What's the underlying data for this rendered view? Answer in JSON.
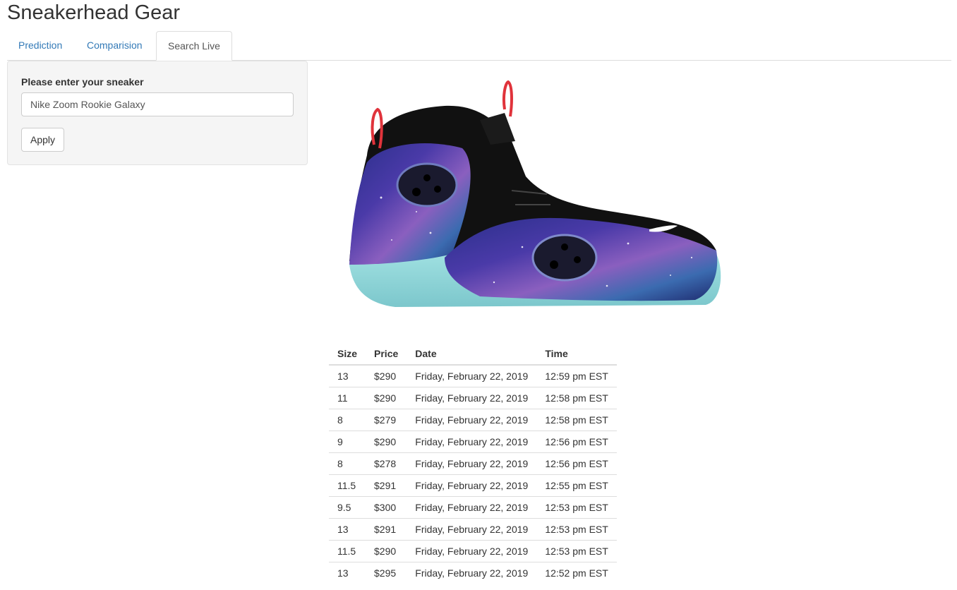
{
  "app": {
    "title": "Sneakerhead Gear"
  },
  "tabs": [
    {
      "label": "Prediction"
    },
    {
      "label": "Comparision"
    },
    {
      "label": "Search Live"
    }
  ],
  "sidebar": {
    "input_label": "Please enter your sneaker",
    "input_value": "Nike Zoom Rookie Galaxy",
    "apply_label": "Apply"
  },
  "table": {
    "headers": [
      "Size",
      "Price",
      "Date",
      "Time"
    ],
    "rows": [
      [
        "13",
        "$290",
        "Friday, February 22, 2019",
        "12:59 pm EST"
      ],
      [
        "11",
        "$290",
        "Friday, February 22, 2019",
        "12:58 pm EST"
      ],
      [
        "8",
        "$279",
        "Friday, February 22, 2019",
        "12:58 pm EST"
      ],
      [
        "9",
        "$290",
        "Friday, February 22, 2019",
        "12:56 pm EST"
      ],
      [
        "8",
        "$278",
        "Friday, February 22, 2019",
        "12:56 pm EST"
      ],
      [
        "11.5",
        "$291",
        "Friday, February 22, 2019",
        "12:55 pm EST"
      ],
      [
        "9.5",
        "$300",
        "Friday, February 22, 2019",
        "12:53 pm EST"
      ],
      [
        "13",
        "$291",
        "Friday, February 22, 2019",
        "12:53 pm EST"
      ],
      [
        "11.5",
        "$290",
        "Friday, February 22, 2019",
        "12:53 pm EST"
      ],
      [
        "13",
        "$295",
        "Friday, February 22, 2019",
        "12:52 pm EST"
      ]
    ]
  },
  "colors": {
    "link": "#337ab7",
    "border": "#dddddd",
    "well": "#f5f5f5"
  }
}
